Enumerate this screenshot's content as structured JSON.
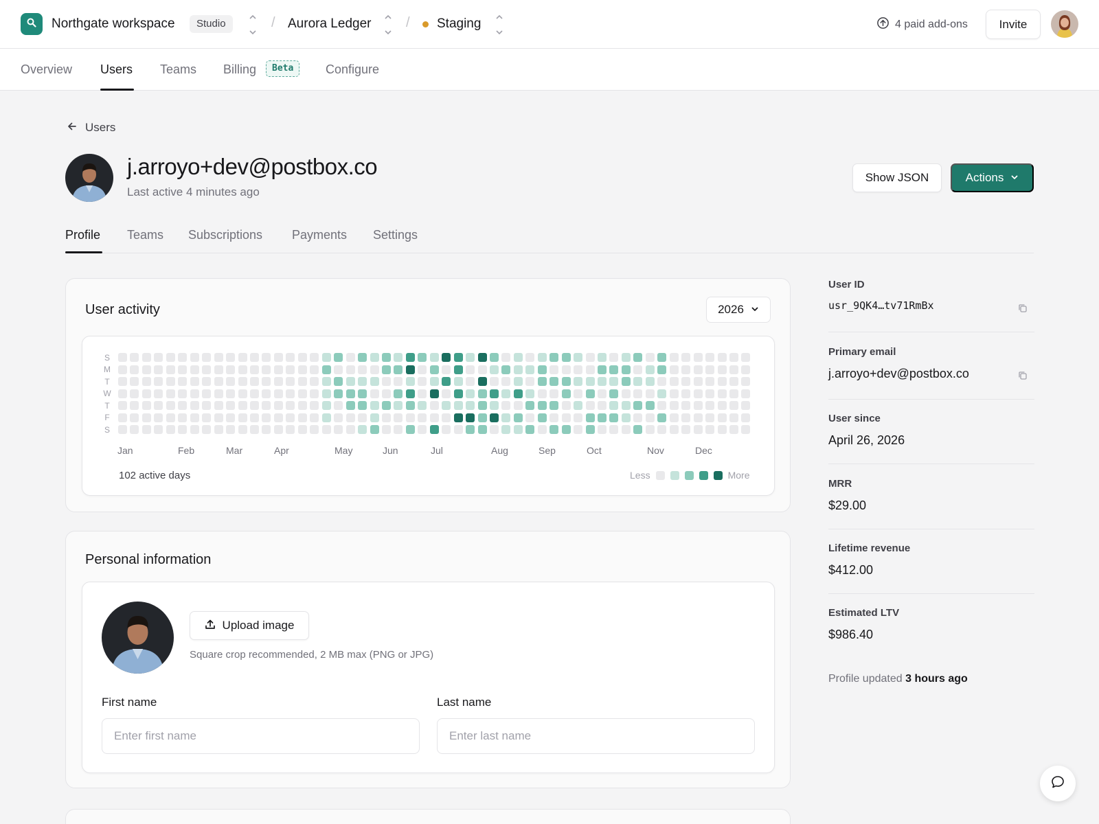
{
  "topbar": {
    "workspace": "Northgate workspace",
    "workspace_badge": "Studio",
    "project": "Aurora Ledger",
    "environment": "Staging",
    "environment_color": "#d99a2b",
    "addons": "4 paid add-ons",
    "invite_label": "Invite"
  },
  "mainnav": {
    "tabs": [
      {
        "label": "Overview"
      },
      {
        "label": "Users",
        "active": true
      },
      {
        "label": "Teams"
      },
      {
        "label": "Billing",
        "badge": "Beta"
      },
      {
        "label": "Configure"
      }
    ]
  },
  "page": {
    "back_label": "Users",
    "email": "j.arroyo+dev@postbox.co",
    "last_active": "Last active 4 minutes ago",
    "show_json_label": "Show JSON",
    "actions_label": "Actions",
    "subtabs": [
      {
        "label": "Profile",
        "active": true
      },
      {
        "label": "Teams"
      },
      {
        "label": "Subscriptions"
      },
      {
        "label": "Payments"
      },
      {
        "label": "Settings"
      }
    ]
  },
  "activity": {
    "title": "User activity",
    "year": "2026",
    "day_labels": [
      "S",
      "M",
      "T",
      "W",
      "T",
      "F",
      "S"
    ],
    "months": [
      "Jan",
      "Feb",
      "Mar",
      "Apr",
      "May",
      "Jun",
      "Jul",
      "Aug",
      "Sep",
      "Oct",
      "Nov",
      "Dec"
    ],
    "summary": "102 active days",
    "legend_less": "Less",
    "legend_more": "More",
    "colors": [
      "#e9e9eb",
      "#c5e3db",
      "#8ccbbb",
      "#3f9e89",
      "#1a6e5f"
    ]
  },
  "personal": {
    "title": "Personal information",
    "upload_label": "Upload image",
    "upload_hint": "Square crop recommended, 2 MB max (PNG or JPG)",
    "first_name_label": "First name",
    "first_name_placeholder": "Enter first name",
    "first_name_value": "",
    "last_name_label": "Last name",
    "last_name_placeholder": "Enter last name",
    "last_name_value": ""
  },
  "details": {
    "user_id_label": "User ID",
    "user_id": "usr_9QK4…tv71RmBx",
    "email_label": "Primary email",
    "email": "j.arroyo+dev@postbox.co",
    "since_label": "User since",
    "since": "April 26, 2026",
    "mrr_label": "MRR",
    "mrr": "$29.00",
    "lifetime_label": "Lifetime revenue",
    "lifetime": "$412.00",
    "ltv_label": "Estimated LTV",
    "ltv": "$986.40",
    "updated_prefix": "Profile updated",
    "updated_value": "3 hours ago"
  },
  "icons": {
    "logo": "search-icon",
    "addons": "arrow-up-circle-icon",
    "back": "arrow-left-icon",
    "actions": "chevron-down-icon",
    "upload": "upload-icon",
    "copy": "copy-icon",
    "chat": "chat-bubble-icon"
  }
}
